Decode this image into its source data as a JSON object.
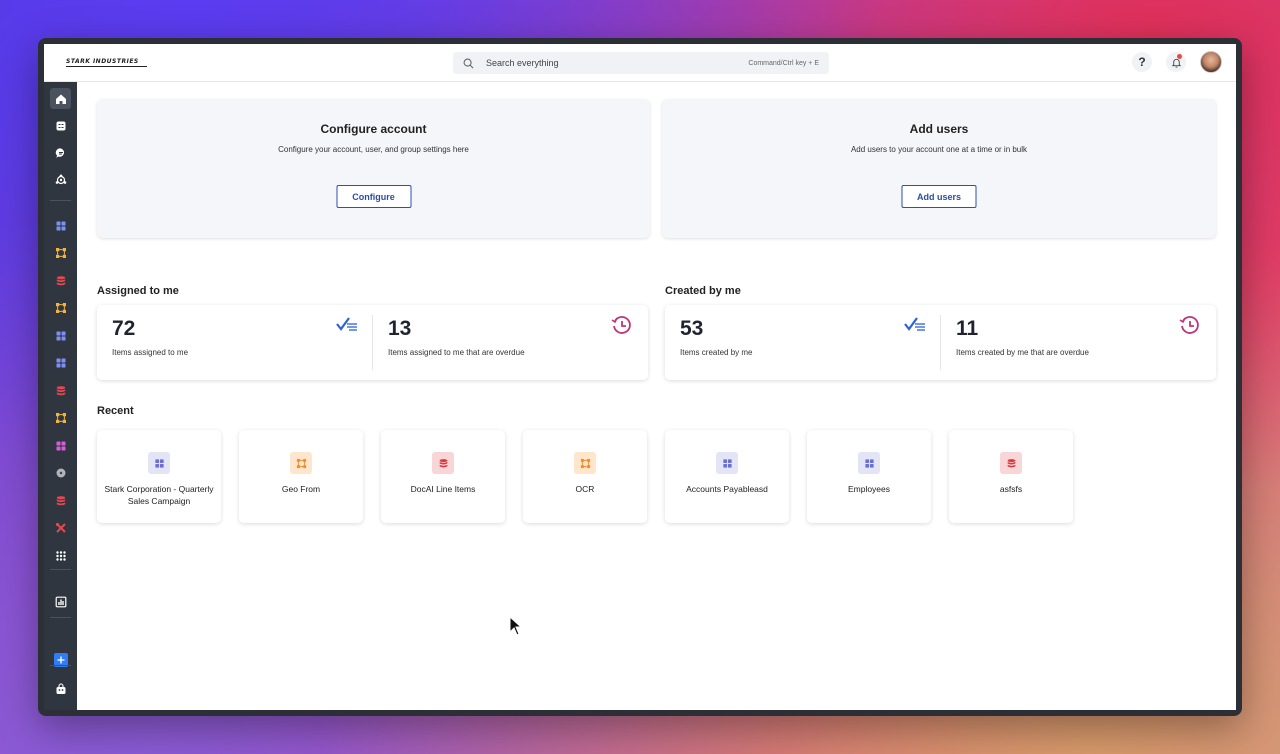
{
  "header": {
    "logo_text": "STARK INDUSTRIES",
    "search_placeholder": "Search everything",
    "search_shortcut": "Command/Ctrl key + E",
    "help_label": "?"
  },
  "sidebar": {
    "items": [
      {
        "icon": "home-icon",
        "color": "#ffffff"
      },
      {
        "icon": "calculator-icon",
        "color": "#ffffff"
      },
      {
        "icon": "chat-icon",
        "color": "#ffffff"
      },
      {
        "icon": "network-icon",
        "color": "#ffffff"
      },
      {
        "icon": "grid-icon",
        "color": "#7e8ff7"
      },
      {
        "icon": "workflow-icon",
        "color": "#f4b33b"
      },
      {
        "icon": "database-icon",
        "color": "#e8474f"
      },
      {
        "icon": "workflow-icon",
        "color": "#f4b33b"
      },
      {
        "icon": "grid-icon",
        "color": "#7e8ff7"
      },
      {
        "icon": "grid-icon",
        "color": "#7e8ff7"
      },
      {
        "icon": "database-icon",
        "color": "#e8474f"
      },
      {
        "icon": "workflow-icon",
        "color": "#f4b33b"
      },
      {
        "icon": "grid-icon",
        "color": "#d65cd8"
      },
      {
        "icon": "circle-icon",
        "color": "#b0b4bc"
      },
      {
        "icon": "database-icon",
        "color": "#e8474f"
      },
      {
        "icon": "tools-icon",
        "color": "#e8474f"
      },
      {
        "icon": "apps-icon",
        "color": "#ffffff"
      },
      {
        "icon": "chart-icon",
        "color": "#ffffff"
      },
      {
        "icon": "plus-icon",
        "color": "#2f7cf6"
      },
      {
        "icon": "bag-icon",
        "color": "#ffffff"
      }
    ]
  },
  "configure": {
    "title": "Configure account",
    "description": "Configure your account, user, and group settings here",
    "button": "Configure"
  },
  "add_users": {
    "title": "Add users",
    "description": "Add users to your account one at a time or in bulk",
    "button": "Add users"
  },
  "assigned": {
    "title": "Assigned to me",
    "total": {
      "value": "72",
      "label": "Items assigned to me"
    },
    "overdue": {
      "value": "13",
      "label": "Items assigned to me that are overdue"
    }
  },
  "created": {
    "title": "Created by me",
    "total": {
      "value": "53",
      "label": "Items created by me"
    },
    "overdue": {
      "value": "11",
      "label": "Items created by me that are overdue"
    }
  },
  "recent": {
    "title": "Recent",
    "items": [
      {
        "label": "Stark Corporation - Quarterly Sales Campaign",
        "icon": "grid-icon",
        "color": "#6b6fd4",
        "bg": "#e4e4f7"
      },
      {
        "label": "Geo From",
        "icon": "workflow-icon",
        "color": "#f08c2e",
        "bg": "#fde6cc"
      },
      {
        "label": "DocAI Line Items",
        "icon": "database-icon",
        "color": "#d93a42",
        "bg": "#f8d6d8"
      },
      {
        "label": "OCR",
        "icon": "workflow-icon",
        "color": "#f08c2e",
        "bg": "#fde6cc"
      },
      {
        "label": "Accounts Payableasd",
        "icon": "grid-icon",
        "color": "#6b6fd4",
        "bg": "#e4e4f7"
      },
      {
        "label": "Employees",
        "icon": "grid-icon",
        "color": "#6b6fd4",
        "bg": "#e4e4f7"
      },
      {
        "label": "asfsfs",
        "icon": "database-icon",
        "color": "#d93a42",
        "bg": "#f8d6d8"
      }
    ]
  }
}
